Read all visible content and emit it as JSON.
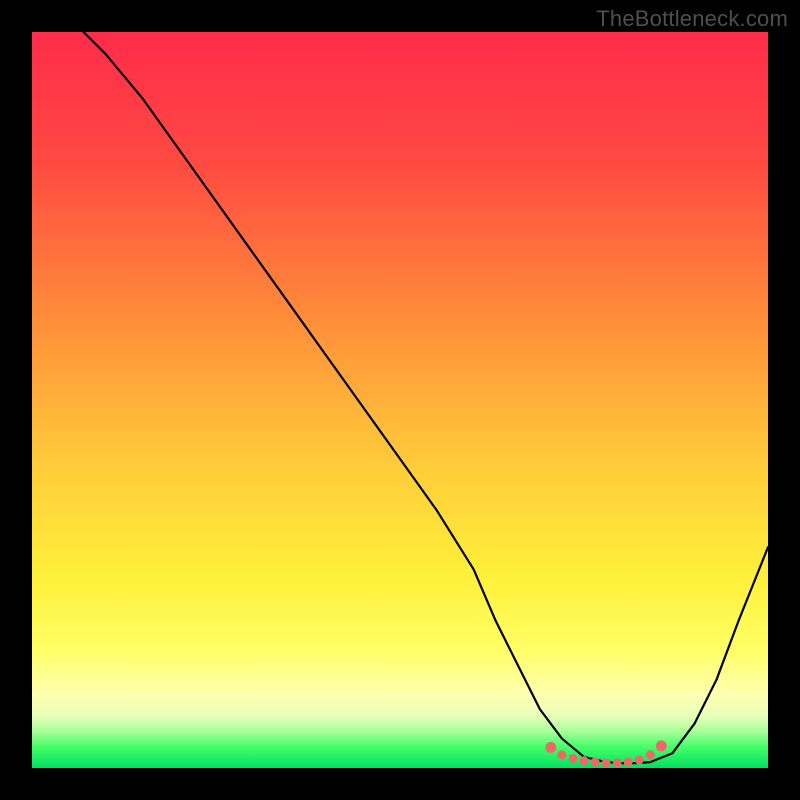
{
  "attribution": "TheBottleneck.com",
  "chart_data": {
    "type": "line",
    "title": "",
    "xlabel": "",
    "ylabel": "",
    "xlim": [
      0,
      100
    ],
    "ylim": [
      0,
      100
    ],
    "series": [
      {
        "name": "bottleneck-curve",
        "x": [
          7,
          10,
          15,
          20,
          25,
          30,
          35,
          40,
          45,
          50,
          55,
          60,
          63,
          66,
          69,
          72,
          75,
          78,
          81,
          84,
          87,
          90,
          93,
          96,
          100
        ],
        "y": [
          100,
          97,
          91,
          84,
          77,
          70,
          63,
          56,
          49,
          42,
          35,
          27,
          20,
          14,
          8,
          4,
          1.5,
          0.8,
          0.6,
          0.8,
          2,
          6,
          12,
          20,
          30
        ]
      },
      {
        "name": "optimal-zone-markers",
        "x": [
          70.5,
          72,
          73.5,
          75,
          76.5,
          78,
          79.5,
          81,
          82.5,
          84,
          85.5
        ],
        "y": [
          2.8,
          1.8,
          1.3,
          1.0,
          0.8,
          0.7,
          0.7,
          0.8,
          1.1,
          1.8,
          3.0
        ]
      }
    ],
    "colors": {
      "curve": "#000000",
      "markers": "#ea6a64"
    }
  }
}
